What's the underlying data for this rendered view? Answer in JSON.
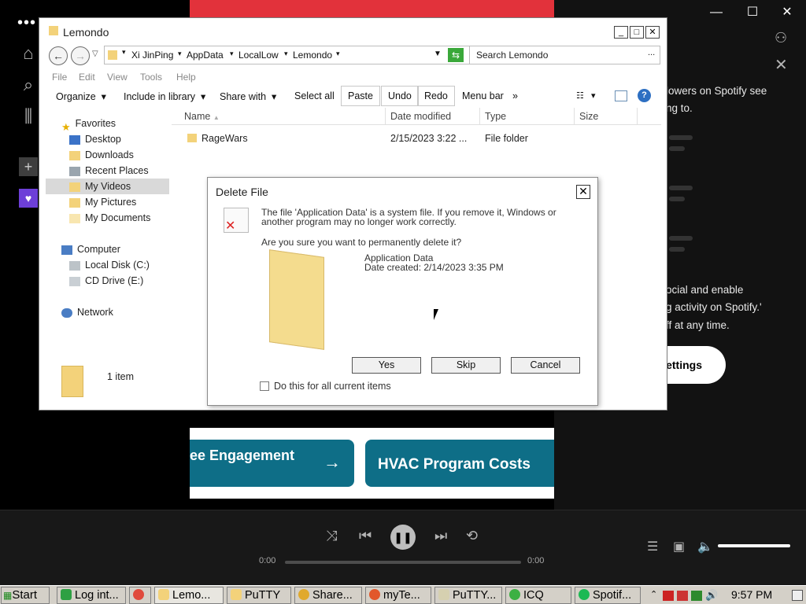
{
  "spotify": {
    "right_text1": "lowers on Spotify see",
    "right_text2": "ng to.",
    "right_text3": "ocial and enable",
    "right_text4": "g activity on Spotify.'",
    "right_text5": "ff at any time.",
    "settings_button": "ettings",
    "banner_card1": "ee Engagement",
    "banner_card1_arrow": "→",
    "banner_card2": "HVAC Program Costs",
    "time_elapsed": "0:00",
    "time_total": "0:00",
    "volume_level": 1.0,
    "progress_level": 0
  },
  "explorer": {
    "title": "Lemondo",
    "breadcrumb": [
      "Xi JinPing",
      "AppData",
      "LocalLow",
      "Lemondo"
    ],
    "search_placeholder": "Search Lemondo",
    "menu": [
      "File",
      "Edit",
      "View",
      "Tools",
      "Help"
    ],
    "commands": {
      "organize": "Organize",
      "include": "Include in library",
      "share": "Share with",
      "select_all": "Select all",
      "paste": "Paste",
      "undo": "Undo",
      "redo": "Redo",
      "menu_bar": "Menu bar",
      "more": "»"
    },
    "nav": {
      "favorites": "Favorites",
      "desktop": "Desktop",
      "downloads": "Downloads",
      "recent": "Recent Places",
      "videos": "My Videos",
      "pictures": "My Pictures",
      "documents": "My Documents",
      "computer": "Computer",
      "local_disk": "Local Disk (C:)",
      "cd_drive": "CD Drive (E:)",
      "network": "Network"
    },
    "columns": [
      "Name",
      "Date modified",
      "Type",
      "Size"
    ],
    "rows": [
      {
        "name": "RageWars",
        "date": "2/15/2023 3:22 ...",
        "type": "File folder",
        "size": ""
      }
    ],
    "status": "1 item"
  },
  "dialog": {
    "title": "Delete File",
    "close": "✕",
    "message_line1": "The file 'Application Data' is a system file. If you remove it, Windows or",
    "message_line2": "another program may no longer work correctly.",
    "question": "Are you sure you want to permanently delete it?",
    "file_name": "Application Data",
    "file_created": "Date created: 2/14/2023 3:35 PM",
    "yes": "Yes",
    "skip": "Skip",
    "cancel": "Cancel",
    "checkbox": "Do this for all current items"
  },
  "taskbar": {
    "start": "Start",
    "tasks": [
      "Log int...",
      "",
      "Lemo...",
      "PuTTY",
      "Share...",
      "myTe...",
      "PuTTY...",
      "ICQ",
      "Spotif..."
    ],
    "clock": "9:57 PM"
  },
  "colors": {
    "spotify_red": "#e2323b",
    "banner_teal": "#0e6e87",
    "taskbar": "#d4d0c8"
  }
}
